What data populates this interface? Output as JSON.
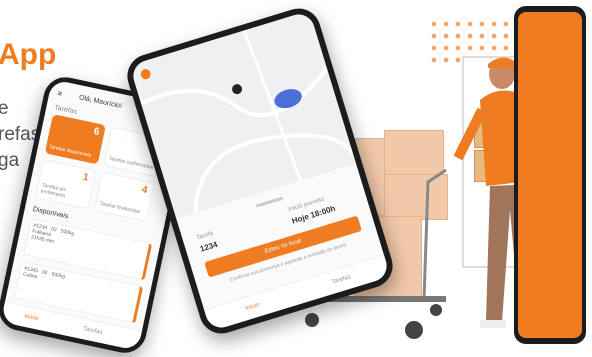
{
  "hero": {
    "title": "App",
    "subtitle_lines": [
      "e",
      "refas",
      "ga"
    ]
  },
  "phone_left": {
    "greeting": "Olá, Maurício!",
    "section_tasks": "Tarefas",
    "tiles": [
      {
        "label": "Tarefas disponíveis",
        "count": "6"
      },
      {
        "label": "Tarefas confirmadas",
        "count": "2"
      },
      {
        "label": "Tarefas em andamento",
        "count": "1"
      },
      {
        "label": "Tarefas finalizadas",
        "count": "4"
      }
    ],
    "section_available": "Disponíveis",
    "cards": [
      {
        "id": "#1234",
        "qty": "02",
        "weight": "500kg",
        "mode": "Fullsend",
        "time": "21h35 min"
      },
      {
        "id": "#1345",
        "qty": "02",
        "weight": "500kg",
        "mode": "Coleta",
        "time": ""
      }
    ],
    "nav": [
      "Início",
      "Tarefas"
    ]
  },
  "phone_middle": {
    "label_left": "Tarefa",
    "value_left": "1234",
    "label_right": "Início previsto",
    "value_right": "Hoje 18:00h",
    "cta": "Estou no local",
    "note": "Confirme sua presença e aguarde a emissão da tarefa",
    "nav": [
      "Início",
      "Tarefas"
    ]
  },
  "colors": {
    "accent": "#f07c22"
  }
}
